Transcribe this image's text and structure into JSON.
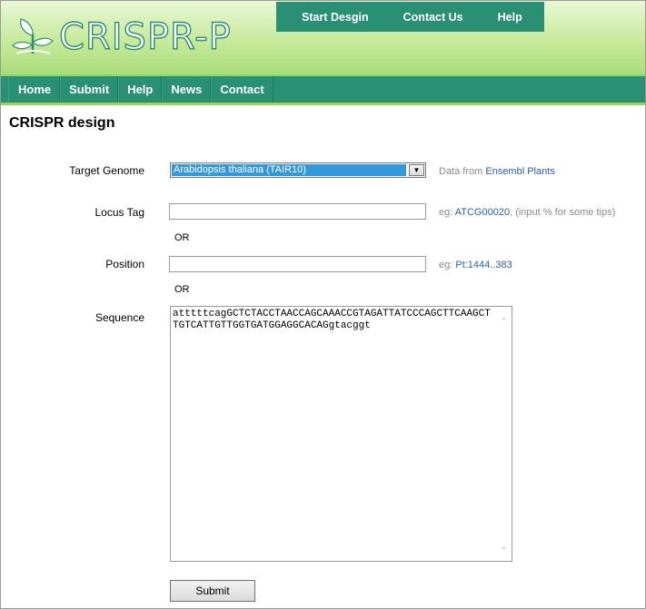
{
  "logo": {
    "text": "CRISPR-P"
  },
  "top_nav": {
    "items": [
      "Start Desgin",
      "Contact Us",
      "Help"
    ]
  },
  "main_nav": {
    "items": [
      "Home",
      "Submit",
      "Help",
      "News",
      "Contact"
    ]
  },
  "page_title": "CRISPR design",
  "form": {
    "target_genome": {
      "label": "Target Genome",
      "selected": "Arabidopsis thaliana (TAIR10)",
      "hint_prefix": "Data from ",
      "hint_link": "Ensembl Plants"
    },
    "locus_tag": {
      "label": "Locus Tag",
      "value": "",
      "hint_prefix": "eg: ",
      "hint_link": "ATCG00020",
      "hint_suffix": ", (input % for some tips)"
    },
    "or_label": "OR",
    "position": {
      "label": "Position",
      "value": "",
      "hint_prefix": "eg: ",
      "hint_link": "Pt:1444..383"
    },
    "sequence": {
      "label": "Sequence",
      "value": "atttttcagGCTCTACCTAACCAGCAAACCGTAGATTATCCCAGCTTCAAGCTTGTCATTGTTGGTGATGGAGGCACAGgtacggt"
    },
    "submit_label": "Submit"
  },
  "colors": {
    "nav_green": "#2a9074",
    "header_light": "#c6ea9a",
    "link_blue": "#2a5db0",
    "select_blue": "#3399dd"
  }
}
